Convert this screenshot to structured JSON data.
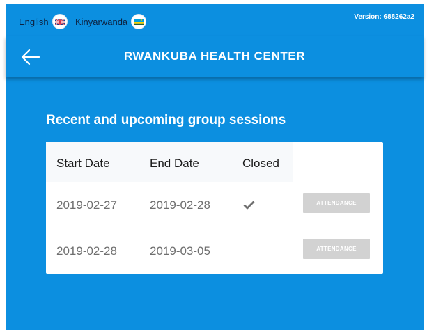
{
  "topbar": {
    "languages": [
      {
        "label": "English",
        "icon": "uk-flag-icon"
      },
      {
        "label": "Kinyarwanda",
        "icon": "rwanda-flag-icon"
      }
    ],
    "version": "Version: 688262a2"
  },
  "header": {
    "back_icon": "arrow-left-icon",
    "title": "RWANKUBA HEALTH CENTER"
  },
  "main": {
    "section_title": "Recent and upcoming group sessions",
    "table": {
      "columns": [
        "Start Date",
        "End Date",
        "Closed"
      ],
      "rows": [
        {
          "start": "2019-02-27",
          "end": "2019-02-28",
          "closed": true,
          "action": "ATTENDANCE"
        },
        {
          "start": "2019-02-28",
          "end": "2019-03-05",
          "closed": false,
          "action": "ATTENDANCE"
        }
      ]
    }
  },
  "colors": {
    "primary": "#0c8fe0",
    "button_disabled": "#d2d2d2",
    "text_muted": "#6f6f6f"
  }
}
